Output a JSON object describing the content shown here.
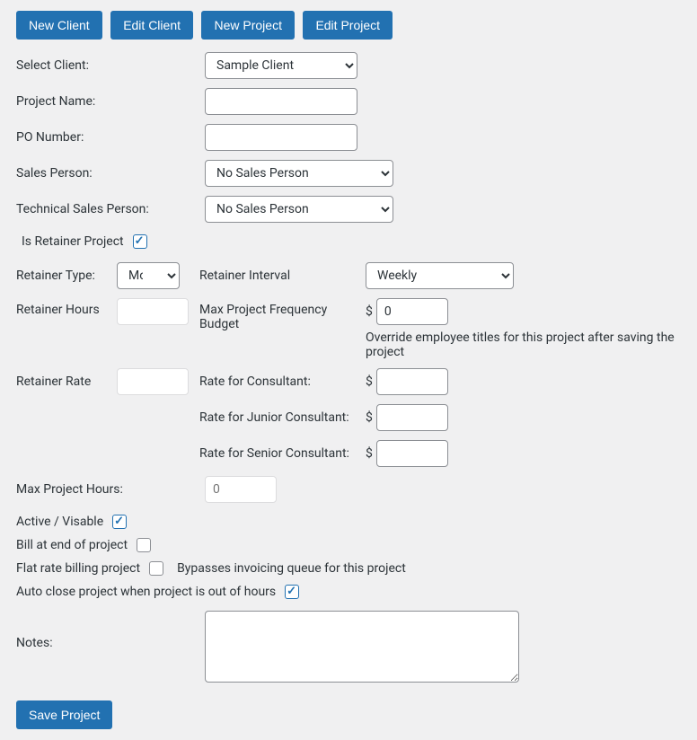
{
  "buttons": {
    "new_client": "New Client",
    "edit_client": "Edit Client",
    "new_project": "New Project",
    "edit_project": "Edit Project",
    "save_project": "Save Project"
  },
  "labels": {
    "select_client": "Select Client:",
    "project_name": "Project Name:",
    "po_number": "PO Number:",
    "sales_person": "Sales Person:",
    "tech_sales_person": "Technical Sales Person:",
    "is_retainer": "Is Retainer Project",
    "retainer_type": "Retainer Type:",
    "retainer_interval": "Retainer Interval",
    "retainer_hours": "Retainer Hours",
    "max_freq_budget": "Max Project Frequency Budget",
    "override_note": "Override employee titles for this project after saving the project",
    "retainer_rate": "Retainer Rate",
    "rate_consultant": "Rate for Consultant:",
    "rate_junior": "Rate for Junior Consultant:",
    "rate_senior": "Rate for Senior Consultant:",
    "max_hours": "Max Project Hours:",
    "active_visible": "Active / Visable",
    "bill_end": "Bill at end of project",
    "flat_rate": "Flat rate billing project",
    "bypass_invoice": "Bypasses invoicing queue for this project",
    "auto_close": "Auto close project when project is out of hours",
    "notes": "Notes:"
  },
  "values": {
    "select_client": "Sample Client",
    "project_name": "",
    "po_number": "",
    "sales_person": "No Sales Person",
    "tech_sales_person": "No Sales Person",
    "is_retainer": true,
    "retainer_type": "Money",
    "retainer_interval": "Weekly",
    "retainer_hours": "",
    "max_freq_budget": "0",
    "retainer_rate": "",
    "rate_consultant": "",
    "rate_junior": "",
    "rate_senior": "",
    "max_hours_placeholder": "0",
    "active_visible": true,
    "bill_end": false,
    "flat_rate": false,
    "auto_close": true,
    "notes": ""
  }
}
